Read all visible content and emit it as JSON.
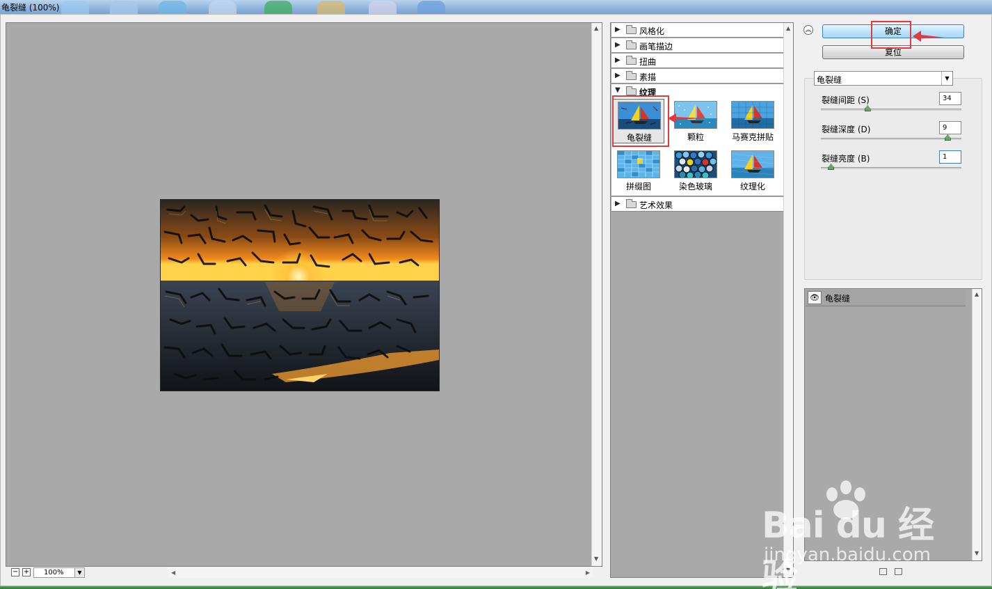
{
  "window": {
    "title": "龟裂缝 (100%)"
  },
  "zoom": {
    "value": "100%"
  },
  "gallery": {
    "categories_top": [
      {
        "label": "风格化"
      },
      {
        "label": "画笔描边"
      },
      {
        "label": "扭曲"
      },
      {
        "label": "素描"
      },
      {
        "label": "纹理"
      }
    ],
    "texture_filters": [
      {
        "label": "龟裂缝",
        "selected": true
      },
      {
        "label": "颗粒"
      },
      {
        "label": "马赛克拼贴"
      },
      {
        "label": "拼缀图"
      },
      {
        "label": "染色玻璃"
      },
      {
        "label": "纹理化"
      }
    ],
    "categories_bottom": [
      {
        "label": "艺术效果"
      }
    ]
  },
  "actions": {
    "ok_label": "确定",
    "reset_label": "复位"
  },
  "settings": {
    "filter_select": "龟裂缝",
    "params": [
      {
        "label": "裂缝间距 (S)",
        "value": "34",
        "position": 0.33
      },
      {
        "label": "裂缝深度 (D)",
        "value": "9",
        "position": 0.9
      },
      {
        "label": "裂缝亮度 (B)",
        "value": "1",
        "position": 0.07
      }
    ]
  },
  "layers": {
    "items": [
      {
        "label": "龟裂缝"
      }
    ]
  },
  "watermark": {
    "brand": "Bai du 经验",
    "url": "jingyan.baidu.com"
  },
  "colors": {
    "annotation_red": "#e0393e",
    "ok_blue": "#a6d8f5",
    "canvas_gray": "#a9a9a9"
  }
}
